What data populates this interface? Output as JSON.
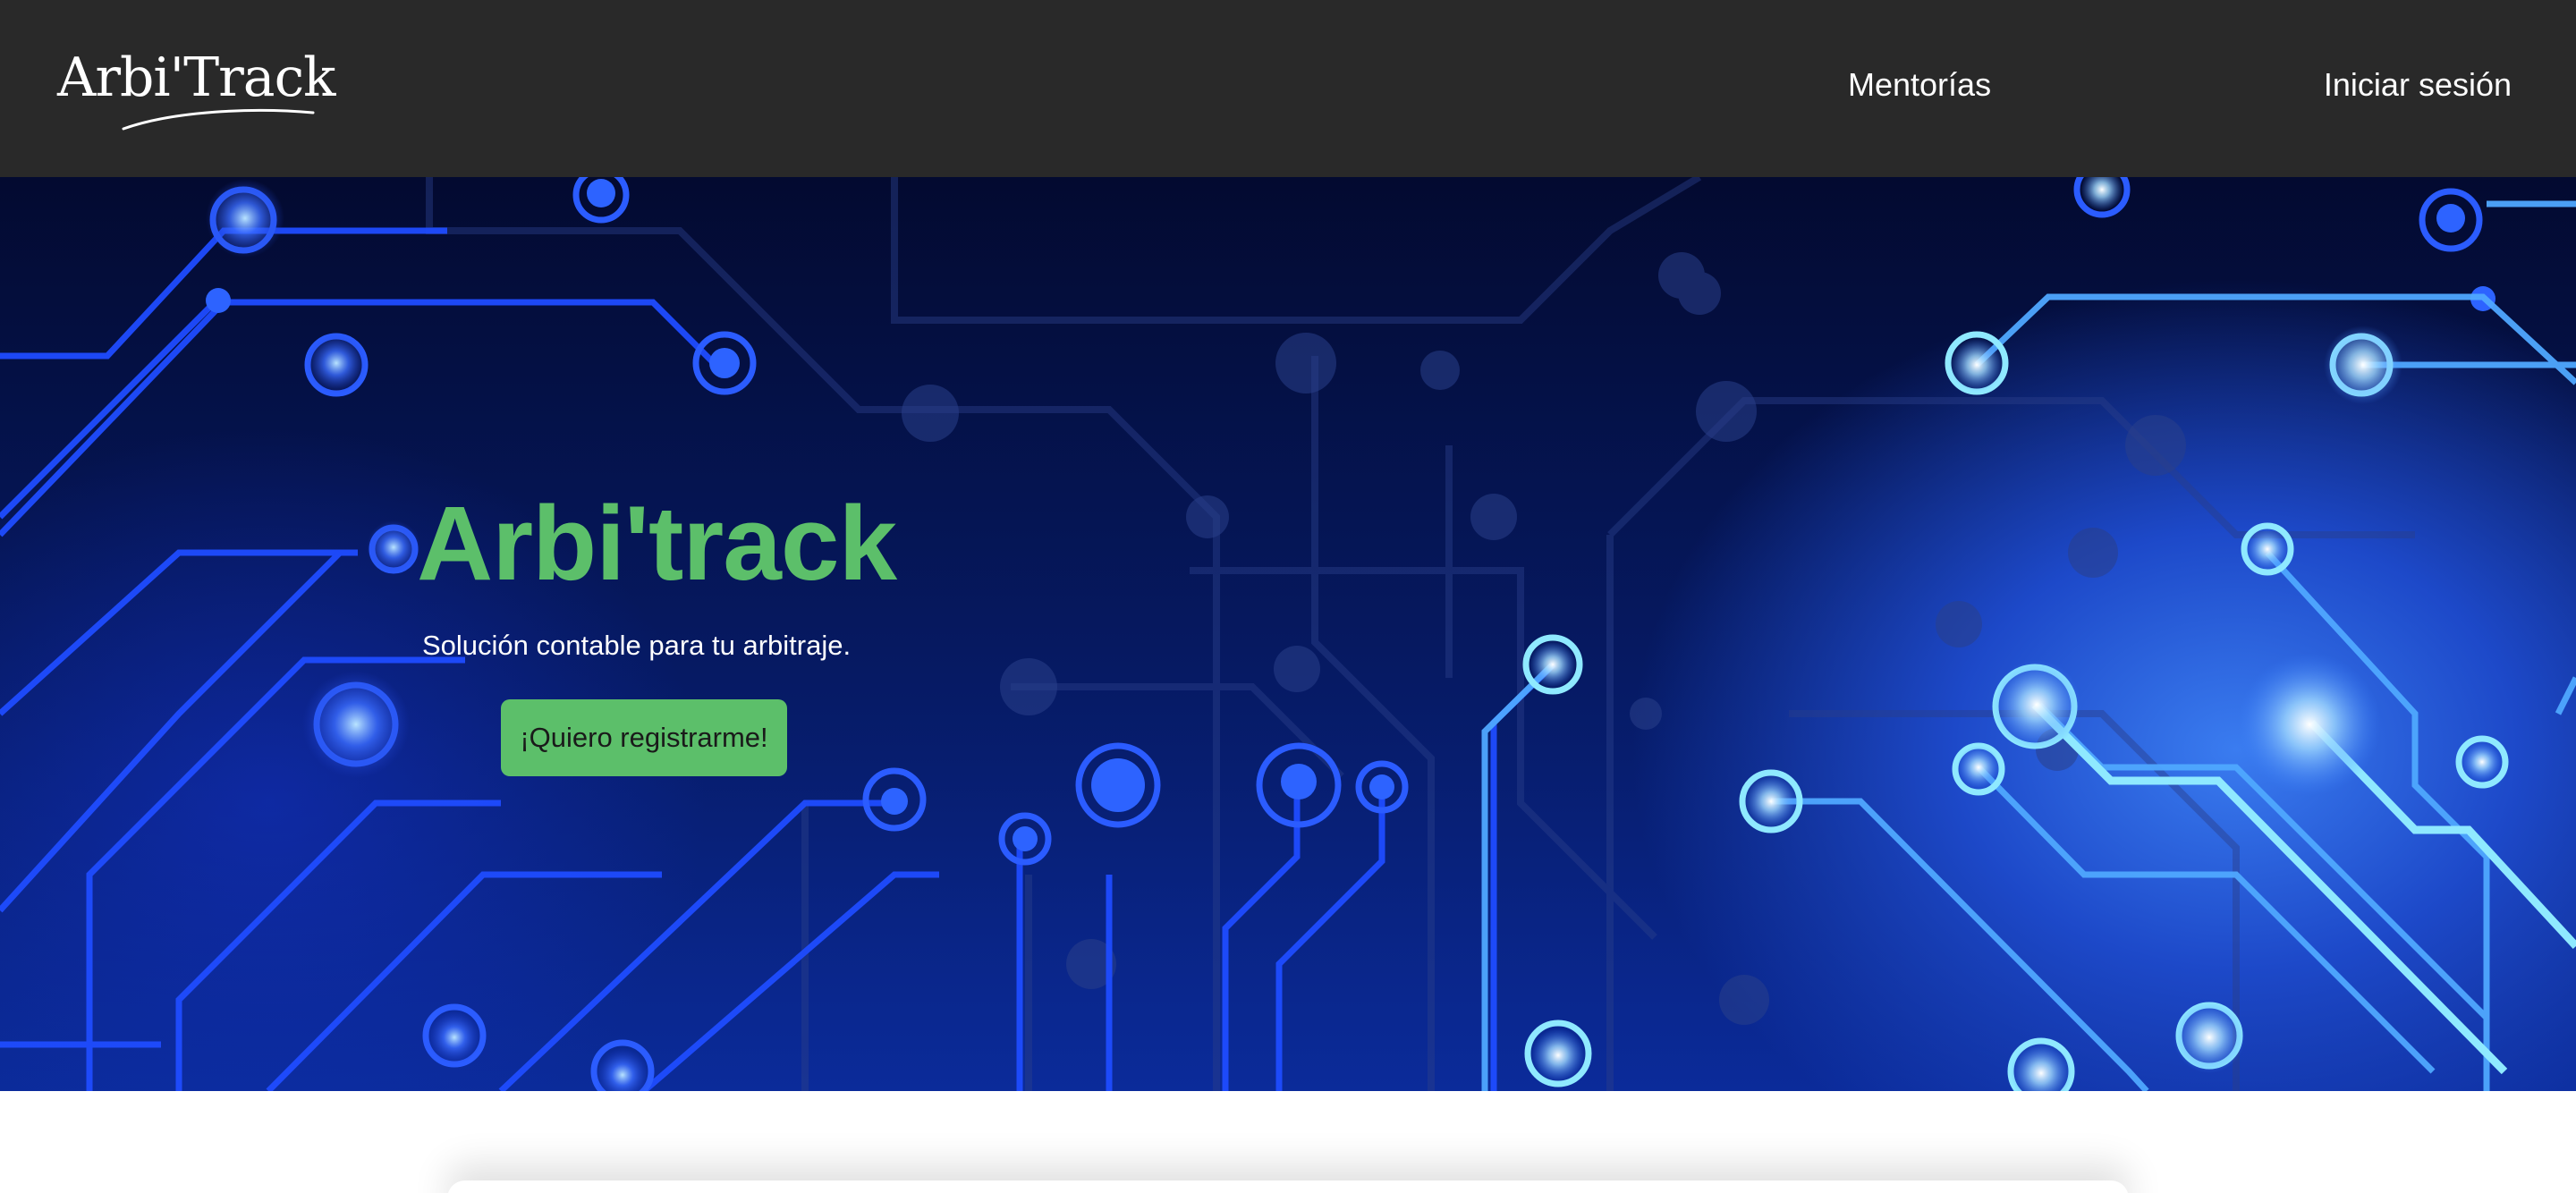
{
  "navbar": {
    "logo_text": "Arbi'Track",
    "links": [
      {
        "label": "Mentorías"
      },
      {
        "label": "Iniciar sesión"
      }
    ]
  },
  "hero": {
    "title": "Arbi'track",
    "subtitle": "Solución contable para tu arbitraje.",
    "cta_label": "¡Quiero registrarme!"
  },
  "colors": {
    "navbar_bg": "#292929",
    "accent_green": "#5cbf6a",
    "hero_blue": "#1d49c9"
  }
}
